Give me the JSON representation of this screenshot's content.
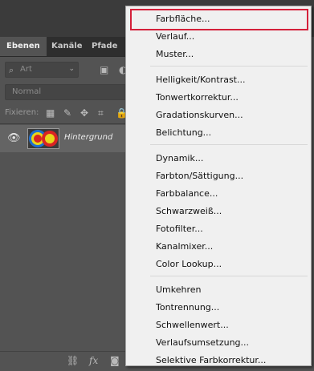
{
  "panel": {
    "tabs": [
      {
        "label": "Ebenen",
        "active": true
      },
      {
        "label": "Kanäle",
        "active": false
      },
      {
        "label": "Pfade",
        "active": false
      }
    ],
    "filter": {
      "label": "Art"
    },
    "blend_mode": "Normal",
    "lock_label": "Fixieren:",
    "layers": [
      {
        "name": "Hintergrund",
        "visible": true
      }
    ]
  },
  "menu": {
    "highlighted_item": "Farbfläche...",
    "groups": [
      [
        "Farbfläche...",
        "Verlauf...",
        "Muster..."
      ],
      [
        "Helligkeit/Kontrast...",
        "Tonwertkorrektur...",
        "Gradationskurven...",
        "Belichtung..."
      ],
      [
        "Dynamik...",
        "Farbton/Sättigung...",
        "Farbbalance...",
        "Schwarzweiß...",
        "Fotofilter...",
        "Kanalmixer...",
        "Color Lookup..."
      ],
      [
        "Umkehren",
        "Tontrennung...",
        "Schwellenwert...",
        "Verlaufsumsetzung...",
        "Selektive Farbkorrektur..."
      ]
    ]
  },
  "colors": {
    "panel_bg": "#535353",
    "menu_bg": "#f0f0f0",
    "highlight_border": "#d4203a"
  }
}
